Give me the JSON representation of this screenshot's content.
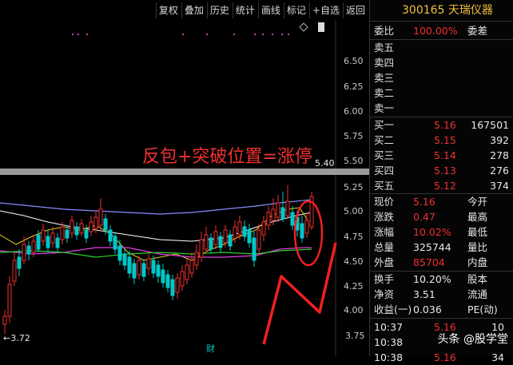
{
  "toolbar": {
    "buttons": [
      "复权",
      "叠加",
      "历史",
      "统计",
      "画线",
      "标记",
      "+自选",
      "返回"
    ]
  },
  "stock": {
    "code": "300165",
    "name": "天瑞仪器"
  },
  "chart": {
    "annotation": "反包+突破位置=涨停",
    "price_labels": [
      "6.50",
      "6.25",
      "6.00",
      "5.75",
      "5.50",
      "5.25",
      "5.00",
      "4.75",
      "4.50",
      "4.25",
      "4.00",
      "3.75"
    ],
    "marker_high": "5.40",
    "marker_low": "3.72",
    "bottom_char": "财",
    "diamond_icon": "diamond-icon",
    "up_color": "#f03030",
    "down_color": "#00c8c8"
  },
  "panel": {
    "weibi_label": "委比",
    "weibi_value": "100.00%",
    "weicha_label": "委差",
    "sell": [
      "卖五",
      "卖四",
      "卖三",
      "卖二",
      "卖一"
    ],
    "buy": [
      {
        "label": "买一",
        "price": "5.16",
        "vol": "167501"
      },
      {
        "label": "买二",
        "price": "5.15",
        "vol": "392"
      },
      {
        "label": "买三",
        "price": "5.14",
        "vol": "278"
      },
      {
        "label": "买四",
        "price": "5.13",
        "vol": "276"
      },
      {
        "label": "买五",
        "price": "5.12",
        "vol": "374"
      }
    ],
    "quote": [
      {
        "l1": "现价",
        "v1": "5.16",
        "l2": "今开"
      },
      {
        "l1": "涨跌",
        "v1": "0.47",
        "l2": "最高"
      },
      {
        "l1": "涨幅",
        "v1": "10.02%",
        "l2": "最低"
      },
      {
        "l1": "总量",
        "v1": "325744",
        "l2": "量比"
      },
      {
        "l1": "外盘",
        "v1": "85704",
        "l2": "内盘"
      }
    ],
    "stats": [
      {
        "l1": "换手",
        "v1": "10.20%",
        "l2": "股本"
      },
      {
        "l1": "净资",
        "v1": "3.51",
        "l2": "流通"
      },
      {
        "l1": "收益(一)",
        "v1": "0.036",
        "l2": "PE(动)"
      }
    ],
    "ticks": [
      {
        "t": "10:37",
        "p": "5.16",
        "v": "10"
      },
      {
        "t": "10:38",
        "p": "",
        "v": ""
      },
      {
        "t": "10:38",
        "p": "5.16",
        "v": "34"
      }
    ]
  },
  "watermark": "头条 @股学堂"
}
